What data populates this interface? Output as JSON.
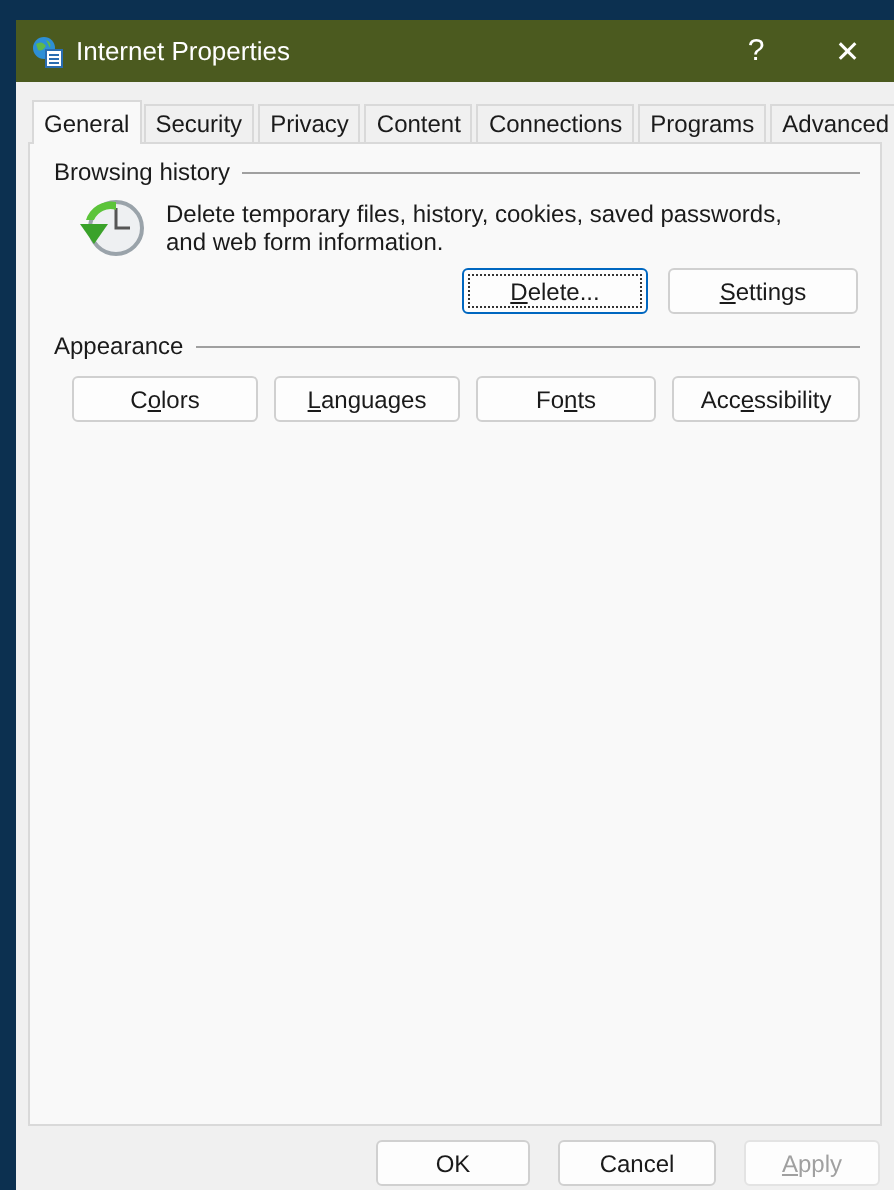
{
  "window": {
    "title": "Internet Properties",
    "help": "?",
    "close": "✕"
  },
  "tabs": [
    {
      "label": "General",
      "selected": true
    },
    {
      "label": "Security",
      "selected": false
    },
    {
      "label": "Privacy",
      "selected": false
    },
    {
      "label": "Content",
      "selected": false
    },
    {
      "label": "Connections",
      "selected": false
    },
    {
      "label": "Programs",
      "selected": false
    },
    {
      "label": "Advanced",
      "selected": false
    }
  ],
  "browsing_history": {
    "heading": "Browsing history",
    "description": "Delete temporary files, history, cookies, saved passwords, and web form information.",
    "buttons": [
      {
        "label": {
          "key": "D",
          "after": "elete..."
        },
        "focused": true
      },
      {
        "label": {
          "key": "S",
          "after": "ettings"
        },
        "focused": false
      }
    ]
  },
  "appearance": {
    "heading": "Appearance",
    "buttons": [
      {
        "label": {
          "before": "C",
          "key": "o",
          "after": "lors"
        },
        "focused": false
      },
      {
        "label": {
          "key": "L",
          "after": "anguages"
        },
        "focused": false
      },
      {
        "label": {
          "before": "Fo",
          "key": "n",
          "after": "ts"
        },
        "focused": false
      },
      {
        "label": {
          "before": "Acc",
          "key": "e",
          "after": "ssibility"
        },
        "focused": false
      }
    ]
  },
  "dialog_buttons": [
    {
      "label": {
        "before": "OK"
      },
      "disabled": false
    },
    {
      "label": {
        "before": "Cancel"
      },
      "disabled": false
    },
    {
      "label": {
        "key": "A",
        "after": "pply"
      },
      "disabled": true
    }
  ]
}
